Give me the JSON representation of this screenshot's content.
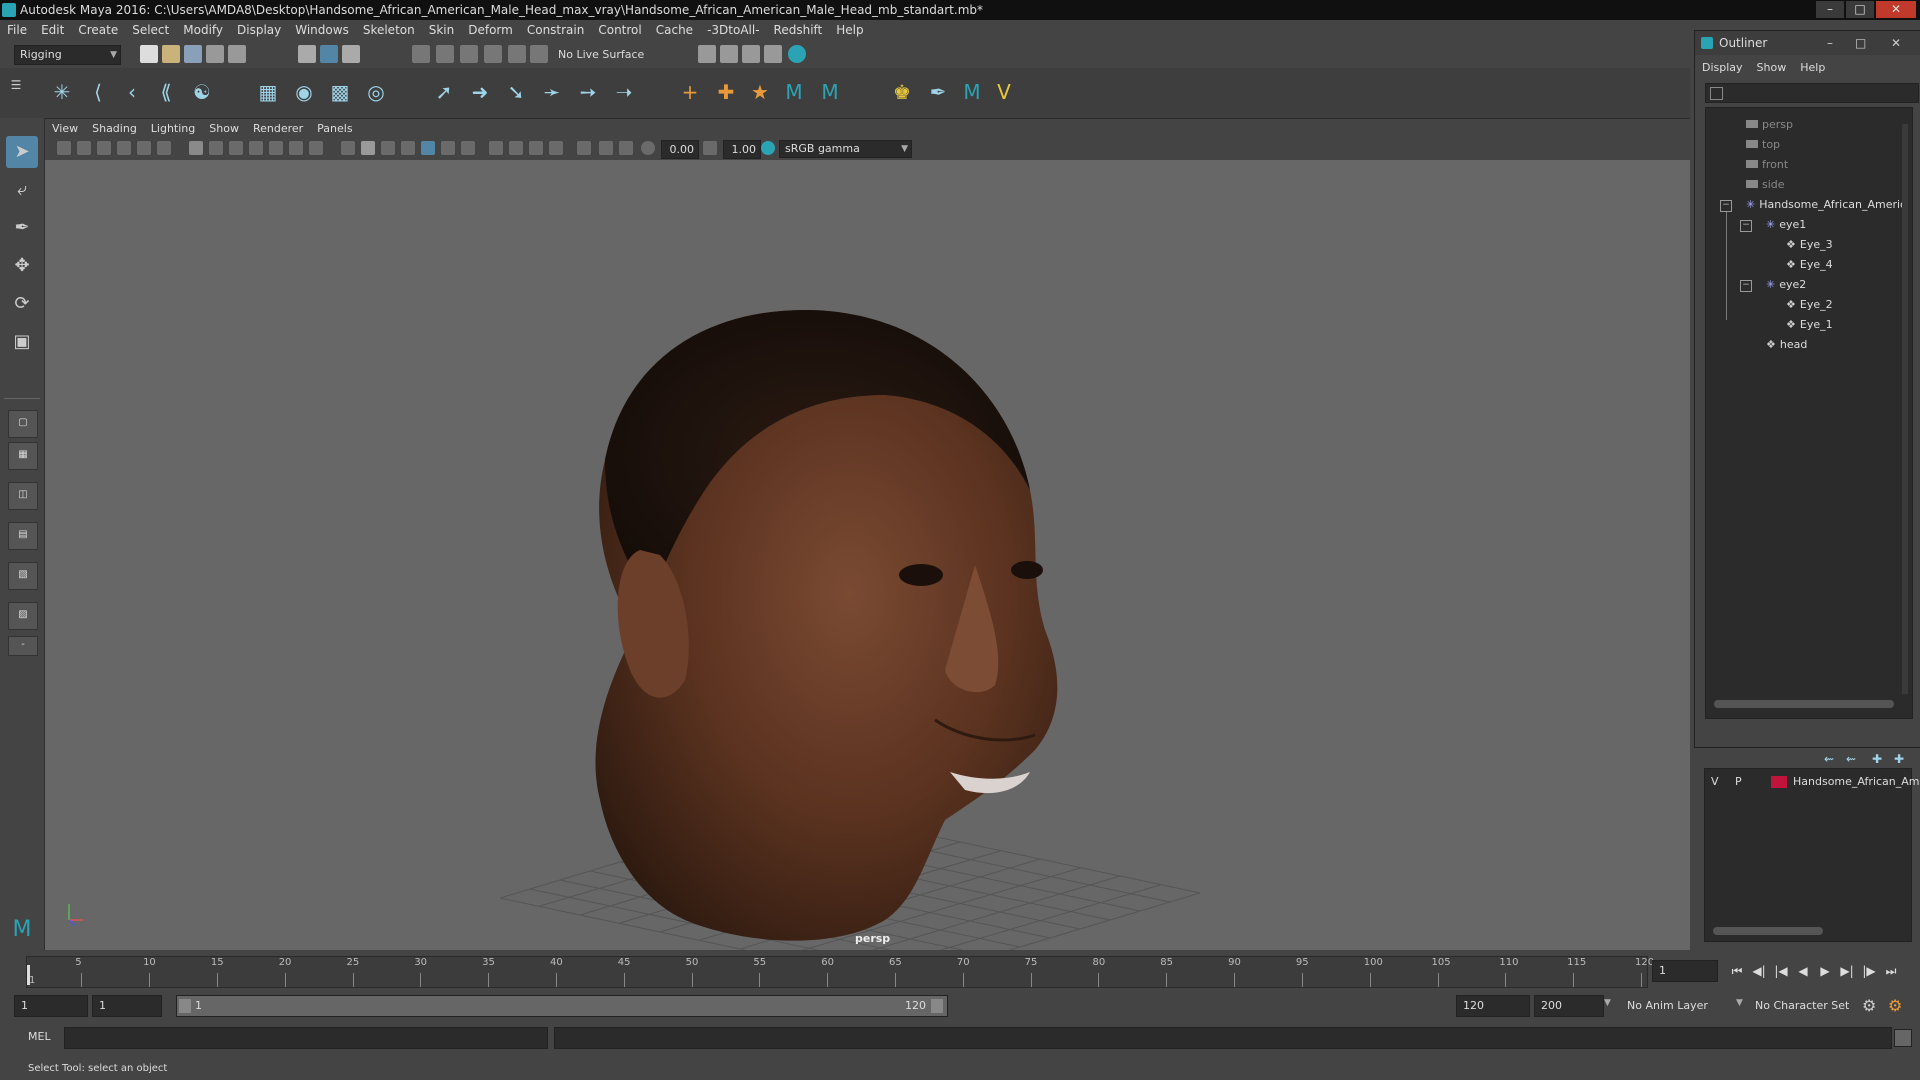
{
  "window": {
    "title": "Autodesk Maya 2016: C:\\Users\\AMDA8\\Desktop\\Handsome_African_American_Male_Head_max_vray\\Handsome_African_American_Male_Head_mb_standart.mb*"
  },
  "menubar": [
    "File",
    "Edit",
    "Create",
    "Select",
    "Modify",
    "Display",
    "Windows",
    "Skeleton",
    "Skin",
    "Deform",
    "Constrain",
    "Control",
    "Cache",
    "-3DtoAll-",
    "Redshift",
    "Help"
  ],
  "statusline": {
    "menuset": "Rigging",
    "live_surface": "No Live Surface"
  },
  "panel": {
    "menu": [
      "View",
      "Shading",
      "Lighting",
      "Show",
      "Renderer",
      "Panels"
    ],
    "exposure": "0.00",
    "gamma": "1.00",
    "color_space": "sRGB gamma",
    "camera_label": "persp"
  },
  "outliner": {
    "title": "Outliner",
    "menu": [
      "Display",
      "Show",
      "Help"
    ],
    "items": [
      {
        "label": "persp"
      },
      {
        "label": "top"
      },
      {
        "label": "front"
      },
      {
        "label": "side"
      },
      {
        "label": "Handsome_African_Americ"
      },
      {
        "label": "eye1"
      },
      {
        "label": "Eye_3"
      },
      {
        "label": "Eye_4"
      },
      {
        "label": "eye2"
      },
      {
        "label": "Eye_2"
      },
      {
        "label": "Eye_1"
      },
      {
        "label": "head"
      }
    ]
  },
  "layer_editor": {
    "visible": "V",
    "playback": "P",
    "layer_name": "Handsome_African_Am",
    "layer_color": "#c0143c"
  },
  "timeline": {
    "ticks": [
      "5",
      "10",
      "15",
      "20",
      "25",
      "30",
      "35",
      "40",
      "45",
      "50",
      "55",
      "60",
      "65",
      "70",
      "75",
      "80",
      "85",
      "90",
      "95",
      "100",
      "105",
      "110",
      "115",
      "120"
    ],
    "start_tick": "1",
    "current_frame": "1"
  },
  "range": {
    "start": "1",
    "playback_start": "1",
    "slider_start": "1",
    "slider_end": "120",
    "playback_end": "120",
    "end": "200",
    "anim_layer": "No Anim Layer",
    "character_set": "No Character Set"
  },
  "cmdline": {
    "label": "MEL"
  },
  "helpline": {
    "text": "Select Tool: select an object"
  }
}
